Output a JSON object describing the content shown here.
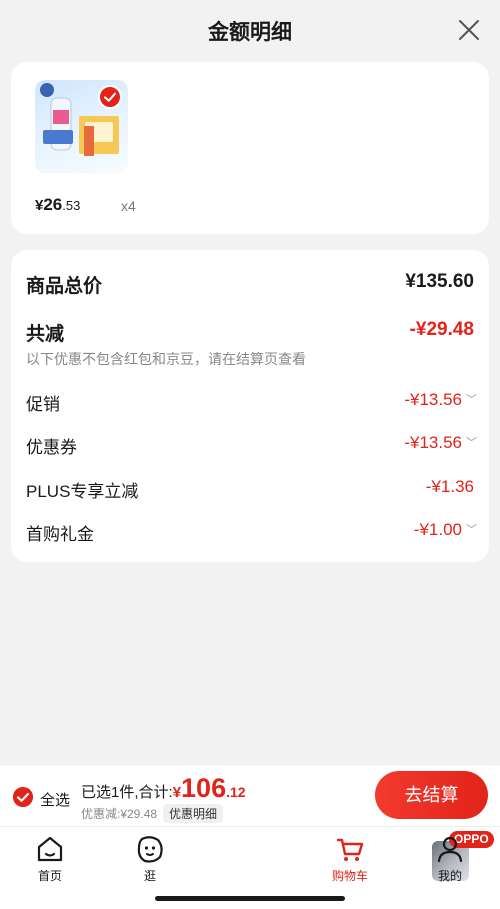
{
  "header": {
    "title": "金额明细"
  },
  "product": {
    "yen": "¥",
    "price_int": "26",
    "price_dec": ".53",
    "qty": "x4"
  },
  "summary": {
    "total_label": "商品总价",
    "total_value": "¥135.60",
    "reduce_label": "共减",
    "reduce_value": "-¥29.48",
    "note": "以下优惠不包含红包和京豆，请在结算页查看",
    "items": [
      {
        "label": "促销",
        "value": "-¥13.56",
        "expandable": true
      },
      {
        "label": "优惠券",
        "value": "-¥13.56",
        "expandable": true
      },
      {
        "label": "PLUS专享立减",
        "value": "-¥1.36",
        "expandable": false
      },
      {
        "label": "首购礼金",
        "value": "-¥1.00",
        "expandable": true
      }
    ]
  },
  "bottom": {
    "select_all": "全选",
    "selected_prefix": "已选1件,合计:",
    "yen": "¥",
    "total_int": "106",
    "total_dec": ".12",
    "discount": "优惠减:¥29.48",
    "detail_button": "优惠明细",
    "checkout": "去结算"
  },
  "tabs": [
    {
      "label": "首页",
      "icon": "home-icon"
    },
    {
      "label": "逛",
      "icon": "smiley-icon"
    },
    {
      "label": "",
      "icon": "oppo-promo-icon",
      "badge": "OPPO"
    },
    {
      "label": "购物车",
      "icon": "cart-icon",
      "active": true
    },
    {
      "label": "我的",
      "icon": "profile-icon"
    }
  ],
  "colors": {
    "accent": "#e2231a",
    "background": "#f2f2f2"
  }
}
